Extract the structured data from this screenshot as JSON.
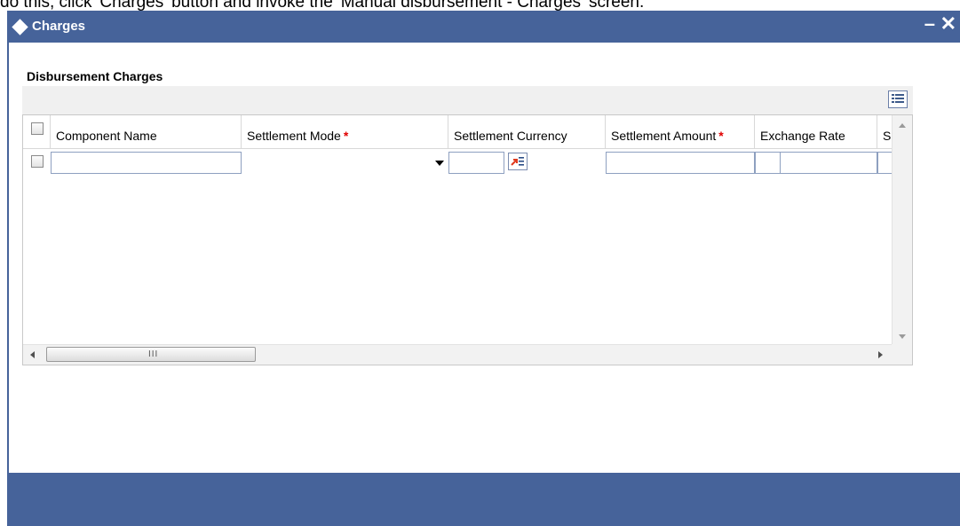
{
  "doc_caption": "do this, click 'Charges' button and invoke the 'Manual disbursement - Charges' screen.",
  "window": {
    "title": "Charges",
    "minimize_label": "–",
    "close_label": "✕"
  },
  "section": {
    "title": "Disbursement Charges"
  },
  "grid": {
    "columns": [
      {
        "label": "Component Name",
        "required": false
      },
      {
        "label": "Settlement Mode",
        "required": true
      },
      {
        "label": "Settlement Currency",
        "required": false
      },
      {
        "label": "Settlement Amount",
        "required": true
      },
      {
        "label": "Exchange Rate",
        "required": false
      },
      {
        "label": "S",
        "required": false
      }
    ],
    "required_marker": "*",
    "rows": [
      {
        "selected": false,
        "component_name": "",
        "settlement_mode": "",
        "settlement_currency": "",
        "settlement_amount": "",
        "exchange_rate": ""
      }
    ],
    "hscroll_grip": "III"
  },
  "icons": {
    "title": "diamond-icon",
    "list_toggle": "list-view-icon",
    "lov": "lov-search-icon"
  },
  "colors": {
    "titlebar": "#46639a",
    "footer": "#46639a",
    "required": "#e00000"
  }
}
